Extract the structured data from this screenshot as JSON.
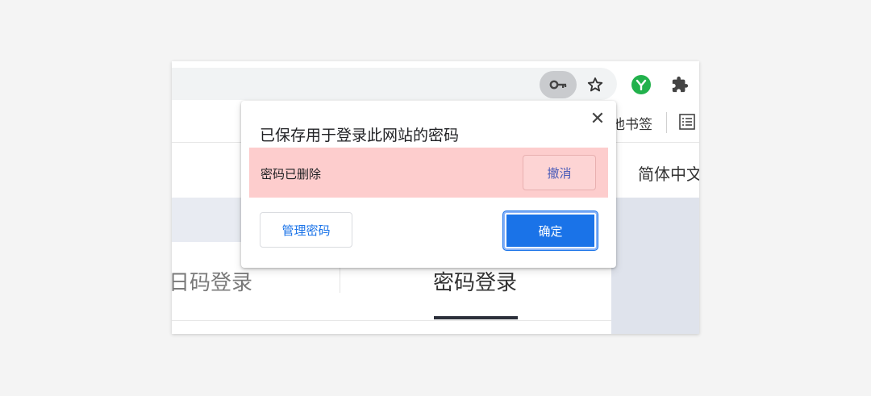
{
  "toolbar": {
    "icons": [
      "key-icon",
      "star-icon",
      "extension-y-icon",
      "extensions-puzzle-icon"
    ],
    "extension_letter": "Y"
  },
  "bookmarks": {
    "other_bookmarks_label": "他书签",
    "icons": [
      "reading-list-icon"
    ]
  },
  "site": {
    "language_label": "简体中文",
    "tabs": [
      {
        "label": "扫码登录",
        "visible_label": "日码登录"
      },
      {
        "label": "密码登录",
        "active": true
      }
    ]
  },
  "popup": {
    "title": "已保存用于登录此网站的密码",
    "deleted_message": "密码已删除",
    "undo_label": "撤消",
    "manage_label": "管理密码",
    "ok_label": "确定",
    "colors": {
      "accent": "#1a73e8",
      "deleted_bg": "#fdcdcd"
    }
  }
}
